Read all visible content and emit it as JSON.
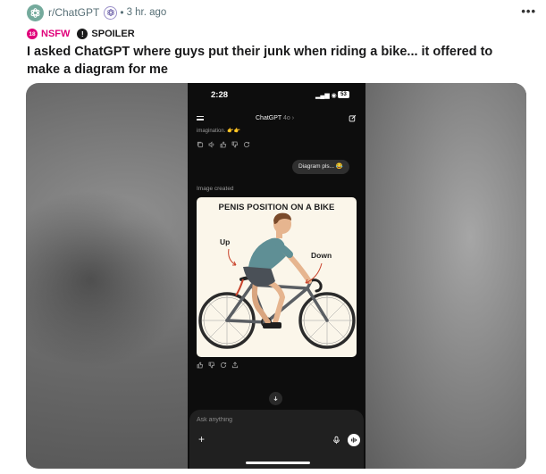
{
  "post": {
    "subreddit": "r/ChatGPT",
    "separator": "•",
    "time": "3 hr. ago",
    "more": "•••",
    "flairs": {
      "nsfw_icon_text": "18",
      "nsfw": "NSFW",
      "spoiler_icon_text": "!",
      "spoiler": "SPOILER"
    },
    "title": "I asked ChatGPT where guys put their junk when riding a bike... it offered to make a diagram for me"
  },
  "phone": {
    "time": "2:28",
    "signal": "▂▄▆ ◉",
    "battery": "53",
    "chat_title": "ChatGPT",
    "chat_model": "4o ›",
    "cut_text": "imagination. 👉👉",
    "user_message": "Diagram pls... 😂",
    "image_created": "Image created",
    "diagram": {
      "title": "PENIS POSITION ON A BIKE",
      "label_up": "Up",
      "label_down": "Down"
    },
    "composer_placeholder": "Ask anything",
    "plus": "+"
  },
  "colors": {
    "nsfw": "#e0007a",
    "subreddit_avatar": "#74aa9c",
    "phone_bg": "#0d0d0d",
    "diagram_bg": "#fbf6ea",
    "rider_shirt": "#5f8f95",
    "arrow": "#c9432b"
  },
  "icons": [
    "openai-logo-icon",
    "award-icon",
    "more-icon",
    "nsfw-icon",
    "spoiler-icon",
    "menu-icon",
    "edit-icon",
    "copy-icon",
    "speaker-icon",
    "thumbs-up-icon",
    "thumbs-down-icon",
    "regenerate-icon",
    "share-icon",
    "arrow-down-icon",
    "mic-icon",
    "voice-mode-icon"
  ]
}
